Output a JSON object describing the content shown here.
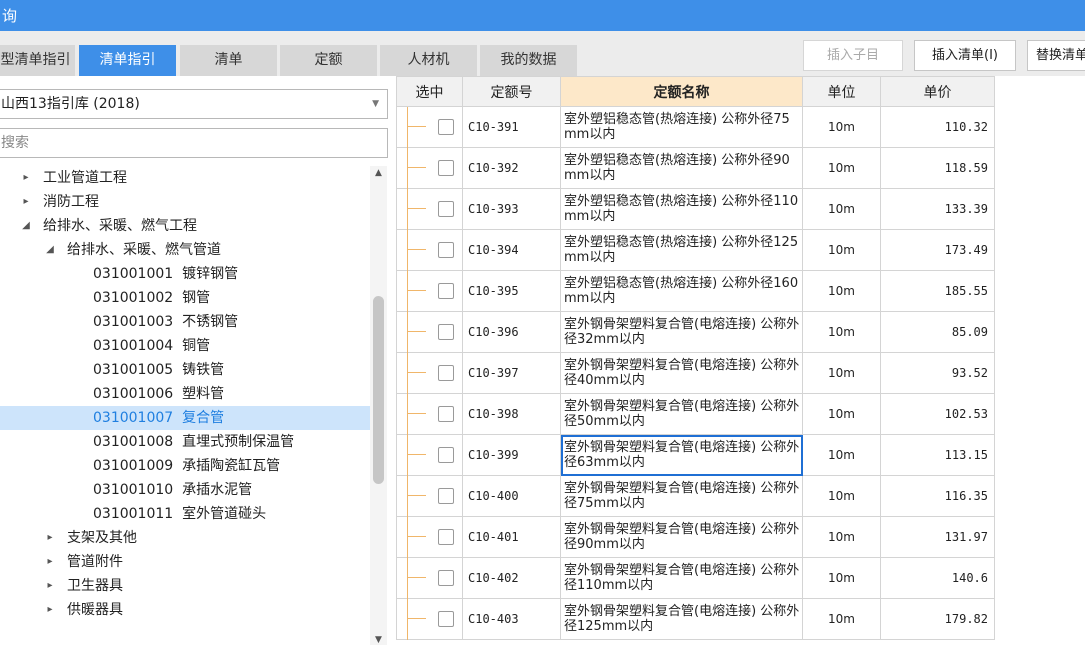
{
  "window": {
    "title": "询"
  },
  "tabs": [
    "型清单指引",
    "清单指引",
    "清单",
    "定额",
    "人材机",
    "我的数据"
  ],
  "toolbar": {
    "insert_child": "插入子目",
    "insert_bill": "插入清单(I)",
    "replace_bill": "替换清单"
  },
  "library": {
    "selected": "山西13指引库 (2018)",
    "search_placeholder": "搜索"
  },
  "tree": [
    {
      "label": "工业管道工程",
      "toggle": "▸"
    },
    {
      "label": "消防工程",
      "toggle": "▸"
    },
    {
      "label": "给排水、采暖、燃气工程",
      "toggle": "◢"
    },
    {
      "label": "给排水、采暖、燃气管道",
      "toggle": "◢"
    },
    {
      "label": "031001001  镀锌钢管"
    },
    {
      "label": "031001002  钢管"
    },
    {
      "label": "031001003  不锈钢管"
    },
    {
      "label": "031001004  铜管"
    },
    {
      "label": "031001005  铸铁管"
    },
    {
      "label": "031001006  塑料管"
    },
    {
      "label": "031001007  复合管",
      "selected": true
    },
    {
      "label": "031001008  直埋式预制保温管"
    },
    {
      "label": "031001009  承插陶瓷缸瓦管"
    },
    {
      "label": "031001010  承插水泥管"
    },
    {
      "label": "031001011  室外管道碰头"
    },
    {
      "label": "支架及其他",
      "toggle": "▸"
    },
    {
      "label": "管道附件",
      "toggle": "▸"
    },
    {
      "label": "卫生器具",
      "toggle": "▸"
    },
    {
      "label": "供暖器具",
      "toggle": "▸"
    }
  ],
  "grid": {
    "columns": [
      "选中",
      "定额号",
      "定额名称",
      "单位",
      "单价"
    ],
    "rows": [
      {
        "code": "C10-391",
        "name": "室外塑铝稳态管(热熔连接) 公称外径75mm以内",
        "unit": "10m",
        "price": "110.32"
      },
      {
        "code": "C10-392",
        "name": "室外塑铝稳态管(热熔连接) 公称外径90mm以内",
        "unit": "10m",
        "price": "118.59"
      },
      {
        "code": "C10-393",
        "name": "室外塑铝稳态管(热熔连接) 公称外径110mm以内",
        "unit": "10m",
        "price": "133.39"
      },
      {
        "code": "C10-394",
        "name": "室外塑铝稳态管(热熔连接) 公称外径125mm以内",
        "unit": "10m",
        "price": "173.49"
      },
      {
        "code": "C10-395",
        "name": "室外塑铝稳态管(热熔连接) 公称外径160mm以内",
        "unit": "10m",
        "price": "185.55"
      },
      {
        "code": "C10-396",
        "name": "室外钢骨架塑料复合管(电熔连接) 公称外径32mm以内",
        "unit": "10m",
        "price": "85.09"
      },
      {
        "code": "C10-397",
        "name": "室外钢骨架塑料复合管(电熔连接) 公称外径40mm以内",
        "unit": "10m",
        "price": "93.52"
      },
      {
        "code": "C10-398",
        "name": "室外钢骨架塑料复合管(电熔连接) 公称外径50mm以内",
        "unit": "10m",
        "price": "102.53"
      },
      {
        "code": "C10-399",
        "name": "室外钢骨架塑料复合管(电熔连接) 公称外径63mm以内",
        "unit": "10m",
        "price": "113.15"
      },
      {
        "code": "C10-400",
        "name": "室外钢骨架塑料复合管(电熔连接) 公称外径75mm以内",
        "unit": "10m",
        "price": "116.35"
      },
      {
        "code": "C10-401",
        "name": "室外钢骨架塑料复合管(电熔连接) 公称外径90mm以内",
        "unit": "10m",
        "price": "131.97"
      },
      {
        "code": "C10-402",
        "name": "室外钢骨架塑料复合管(电熔连接) 公称外径110mm以内",
        "unit": "10m",
        "price": "140.6"
      },
      {
        "code": "C10-403",
        "name": "室外钢骨架塑料复合管(电熔连接) 公称外径125mm以内",
        "unit": "10m",
        "price": "179.82"
      }
    ]
  }
}
